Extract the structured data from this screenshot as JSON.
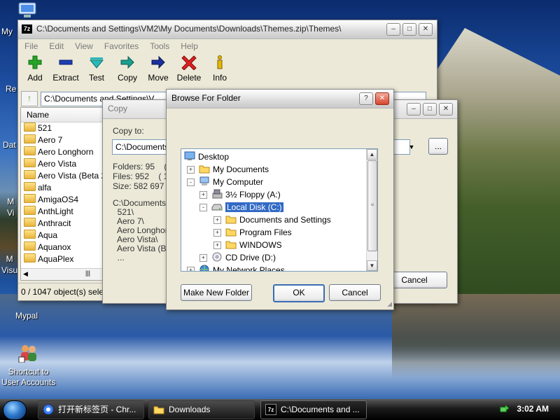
{
  "desktop": {
    "icons": [
      {
        "label": "My"
      },
      {
        "label": "Re"
      },
      {
        "label": "Dat"
      },
      {
        "label": "M\nVi"
      },
      {
        "label": "M\nVisu"
      },
      {
        "label": "Mypal"
      },
      {
        "label": "Shortcut to\nUser Accounts"
      }
    ]
  },
  "main_window": {
    "title": "C:\\Documents and Settings\\VM2\\My Documents\\Downloads\\Themes.zip\\Themes\\",
    "menu": [
      "File",
      "Edit",
      "View",
      "Favorites",
      "Tools",
      "Help"
    ],
    "toolbar": [
      {
        "label": "Add",
        "icon": "plus-icon"
      },
      {
        "label": "Extract",
        "icon": "minus-icon"
      },
      {
        "label": "Test",
        "icon": "check-icon"
      },
      {
        "label": "Copy",
        "icon": "copy-arrow-icon"
      },
      {
        "label": "Move",
        "icon": "move-arrow-icon"
      },
      {
        "label": "Delete",
        "icon": "delete-x-icon"
      },
      {
        "label": "Info",
        "icon": "info-icon"
      }
    ],
    "address": "C:\\Documents and Settings\\V",
    "column_name": "Name",
    "files": [
      "521",
      "Aero 7",
      "Aero Longhorn",
      "Aero Vista",
      "Aero Vista (Beta 2)",
      "alfa",
      "AmigaOS4",
      "AnthLight",
      "Anthracit",
      "Aqua",
      "Aquanox",
      "AquaPlex"
    ],
    "status": "0 / 1047 object(s) selec"
  },
  "copy_dialog": {
    "title": "Copy",
    "copy_to_label": "Copy to:",
    "path_value": "C:\\Documents a",
    "browse_label": "...",
    "folders_line": "Folders: 95    ( 5",
    "files_line": "Files: 952    ( 19",
    "size_line": "Size: 582 697 59",
    "list_text": "C:\\Documents a\n  521\\\n  Aero 7\\\n  Aero Longhorn\n  Aero Vista\\\n  Aero Vista (Bet\n  ...",
    "cancel_label": "Cancel"
  },
  "browse_dialog": {
    "title": "Browse For Folder",
    "tree": [
      {
        "label": "Desktop",
        "depth": 0,
        "toggle": "",
        "icon": "desktop-icon"
      },
      {
        "label": "My Documents",
        "depth": 1,
        "toggle": "+",
        "icon": "folder-icon"
      },
      {
        "label": "My Computer",
        "depth": 1,
        "toggle": "-",
        "icon": "computer-icon"
      },
      {
        "label": "3½ Floppy (A:)",
        "depth": 2,
        "toggle": "+",
        "icon": "floppy-icon"
      },
      {
        "label": "Local Disk (C:)",
        "depth": 2,
        "toggle": "-",
        "icon": "disk-icon",
        "selected": true
      },
      {
        "label": "Documents and Settings",
        "depth": 3,
        "toggle": "+",
        "icon": "folder-icon"
      },
      {
        "label": "Program Files",
        "depth": 3,
        "toggle": "+",
        "icon": "folder-icon"
      },
      {
        "label": "WINDOWS",
        "depth": 3,
        "toggle": "+",
        "icon": "folder-icon"
      },
      {
        "label": "CD Drive (D:)",
        "depth": 2,
        "toggle": "+",
        "icon": "cd-icon"
      },
      {
        "label": "My Network Places",
        "depth": 1,
        "toggle": "+",
        "icon": "network-icon"
      }
    ],
    "make_new_folder_label": "Make New Folder",
    "ok_label": "OK",
    "cancel_label": "Cancel"
  },
  "taskbar": {
    "items": [
      {
        "label": "打开新标签页 - Chr..."
      },
      {
        "label": "Downloads"
      },
      {
        "label": "C:\\Documents and ..."
      }
    ],
    "clock": "3:02 AM"
  },
  "colors": {
    "selection": "#316ac5",
    "taskbar": "#000000",
    "close_button": "#d5462e"
  }
}
